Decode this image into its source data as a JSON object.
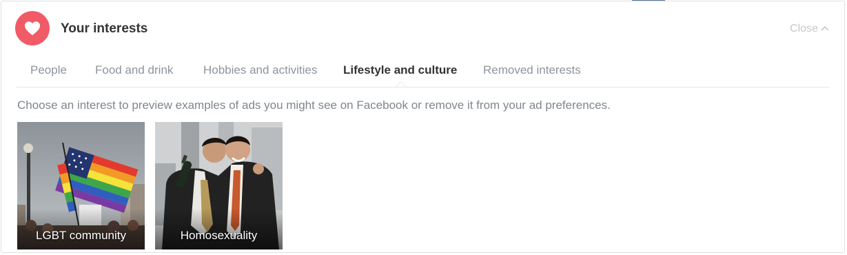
{
  "header": {
    "title": "Your interests",
    "icon": "heart-icon",
    "close_label": "Close",
    "close_icon": "chevron-up-icon",
    "accent_color": "#f05b67"
  },
  "tabs": [
    {
      "label": "People",
      "active": false
    },
    {
      "label": "Food and drink",
      "active": false
    },
    {
      "label": "Hobbies and activities",
      "active": false
    },
    {
      "label": "Lifestyle and culture",
      "active": true
    },
    {
      "label": "Removed interests",
      "active": false
    }
  ],
  "description": "Choose an interest to preview examples of ads you might see on Facebook or remove it from your ad preferences.",
  "interests": [
    {
      "label": "LGBT community",
      "image": "rainbow-flag-photo"
    },
    {
      "label": "Homosexuality",
      "image": "two-men-embracing-photo"
    }
  ]
}
